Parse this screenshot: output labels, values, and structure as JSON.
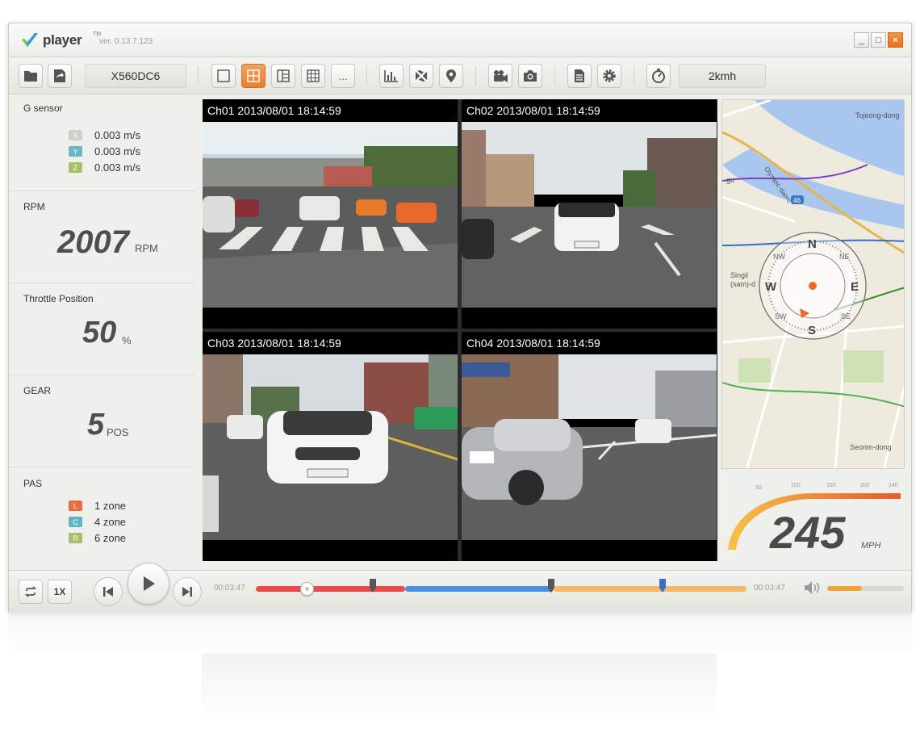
{
  "app": {
    "name": "player",
    "trademark": "TM",
    "version": "ver. 0.13.7.123",
    "window_buttons": {
      "minimize": "_",
      "maximize": "□",
      "close": "×"
    }
  },
  "toolbar": {
    "vehicle_id": "X560DC6",
    "more_label": "...",
    "speed_display": "2kmh",
    "icons": [
      "folder-icon",
      "export-icon",
      "layout-single-icon",
      "layout-quad-icon",
      "layout-side-icon",
      "layout-grid-icon",
      "more-icon",
      "chart-icon",
      "map-off-icon",
      "location-pin-icon",
      "video-camera-icon",
      "photo-camera-icon",
      "document-icon",
      "gear-icon",
      "stopwatch-icon"
    ],
    "active_layout": "layout-quad",
    "accent": "#e97f2c"
  },
  "sidebar": {
    "g_sensor": {
      "title": "G sensor",
      "axes": [
        {
          "label": "X",
          "value": "0.003 m/s",
          "color": "#cfcfcf"
        },
        {
          "label": "Y",
          "value": "0.003 m/s",
          "color": "#69b7c6"
        },
        {
          "label": "Z",
          "value": "0.003 m/s",
          "color": "#a4c06b"
        }
      ]
    },
    "rpm": {
      "title": "RPM",
      "value": "2007",
      "unit": "RPM"
    },
    "throttle": {
      "title": "Throttle Position",
      "value": "50",
      "unit": "%"
    },
    "gear": {
      "title": "GEAR",
      "value": "5",
      "unit": "POS"
    },
    "pas": {
      "title": "PAS",
      "zones": [
        {
          "label": "L",
          "value": "1 zone",
          "color": "#e96d40"
        },
        {
          "label": "C",
          "value": "4 zone",
          "color": "#5eb6c6"
        },
        {
          "label": "R",
          "value": "6 zone",
          "color": "#a4c06b"
        }
      ]
    }
  },
  "channels": [
    {
      "label": "Ch01  2013/08/01   18:14:59"
    },
    {
      "label": "Ch02  2013/08/01   18:14:59"
    },
    {
      "label": "Ch03  2013/08/01   18:14:59"
    },
    {
      "label": "Ch04  2013/08/01   18:14:59"
    }
  ],
  "map": {
    "labels": [
      "Tojeong-dong",
      "Olympic-daero",
      "-gu",
      "46",
      "Singil",
      "(sam)-d",
      "Seorim-dong"
    ],
    "compass": {
      "n": "N",
      "s": "S",
      "e": "E",
      "w": "W",
      "ne": "NE",
      "nw": "NW",
      "se": "SE",
      "sw": "SW"
    }
  },
  "speedometer": {
    "value": "245",
    "unit": "MPH",
    "ticks": [
      "50",
      "100",
      "150",
      "200",
      "240"
    ]
  },
  "playback": {
    "repeat_icon": "repeat-icon",
    "speed": "1X",
    "time_start": "00:03:47",
    "time_end": "00:03:47",
    "progress": 0.103,
    "volume_level": 0.45,
    "colors": {
      "red": "#ec4a4a",
      "blue": "#4c8ee0",
      "orange": "#f5b868"
    }
  }
}
